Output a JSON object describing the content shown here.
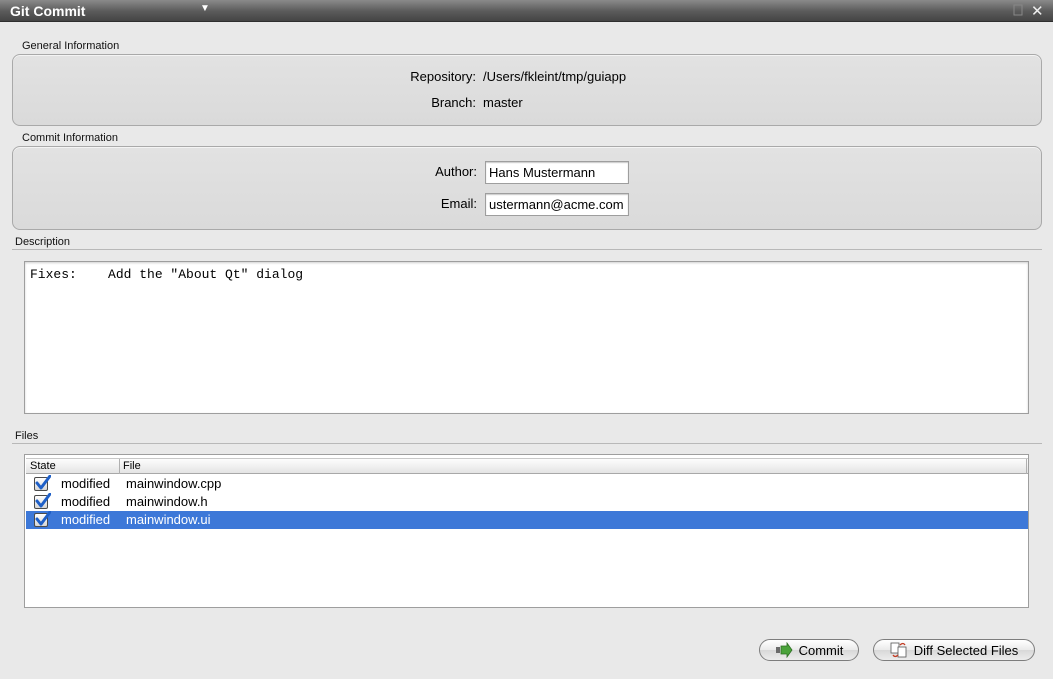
{
  "window": {
    "title": "Git Commit"
  },
  "general": {
    "heading": "General Information",
    "repository_label": "Repository:",
    "repository_value": "/Users/fkleint/tmp/guiapp",
    "branch_label": "Branch:",
    "branch_value": "master"
  },
  "commit_info": {
    "heading": "Commit Information",
    "author_label": "Author:",
    "author_value": "Hans Mustermann",
    "email_label": "Email:",
    "email_value": "ustermann@acme.com"
  },
  "description": {
    "heading": "Description",
    "text": "Fixes:    Add the \"About Qt\" dialog"
  },
  "files": {
    "heading": "Files",
    "columns": [
      "State",
      "File"
    ],
    "rows": [
      {
        "checked": true,
        "state": "modified",
        "file": "mainwindow.cpp",
        "selected": false
      },
      {
        "checked": true,
        "state": "modified",
        "file": "mainwindow.h",
        "selected": false
      },
      {
        "checked": true,
        "state": "modified",
        "file": "mainwindow.ui",
        "selected": true
      }
    ]
  },
  "buttons": {
    "commit_label": "Commit",
    "commit_icon": "commit-arrow-icon",
    "diff_label": "Diff Selected Files",
    "diff_icon": "diff-icon"
  },
  "colors": {
    "selection": "#3d78d8",
    "checkmark": "#1e5fc7"
  }
}
